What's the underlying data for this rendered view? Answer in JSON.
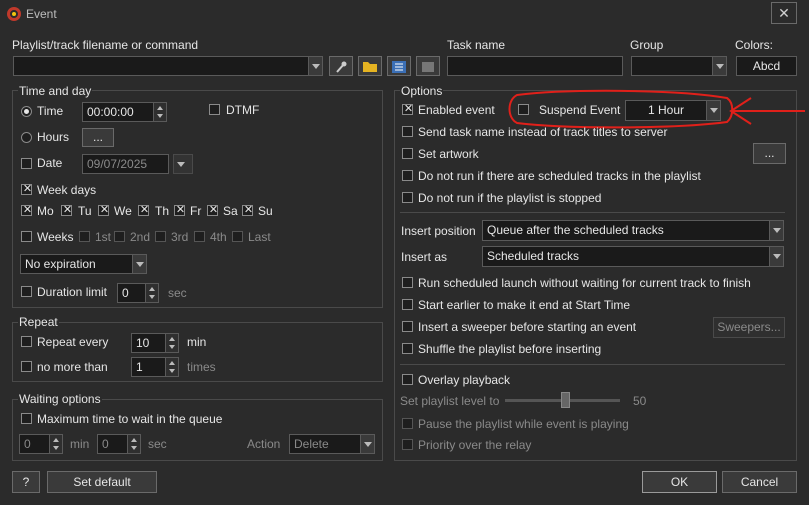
{
  "window": {
    "title": "Event",
    "close": "✕"
  },
  "top": {
    "playlist_label": "Playlist/track filename or command",
    "playlist_value": "",
    "task_label": "Task name",
    "task_value": "",
    "group_label": "Group",
    "group_value": "",
    "colors_label": "Colors:",
    "colors_value": "Abcd"
  },
  "time_and_day": {
    "legend": "Time and day",
    "time_label": "Time",
    "time_value": "00:00:00",
    "dtmf_label": "DTMF",
    "hours_label": "Hours",
    "hours_btn": "...",
    "date_label": "Date",
    "date_value": "09/07/2025",
    "weekdays_label": "Week days",
    "days": [
      "Mo",
      "Tu",
      "We",
      "Th",
      "Fr",
      "Sa",
      "Su"
    ],
    "weeks_label": "Weeks",
    "weeks": [
      "1st",
      "2nd",
      "3rd",
      "4th",
      "Last"
    ],
    "expiration_value": "No expiration",
    "duration_label": "Duration limit",
    "duration_value": "0",
    "duration_unit": "sec"
  },
  "repeat": {
    "legend": "Repeat",
    "repeat_every_label": "Repeat every",
    "repeat_every_value": "10",
    "repeat_every_unit": "min",
    "no_more_label": "no more than",
    "no_more_value": "1",
    "no_more_unit": "times"
  },
  "waiting": {
    "legend": "Waiting options",
    "max_label": "Maximum time to wait in the queue",
    "min_value": "0",
    "min_unit": "min",
    "sec_value": "0",
    "sec_unit": "sec",
    "action_label": "Action",
    "action_value": "Delete"
  },
  "options": {
    "legend": "Options",
    "enabled_label": "Enabled event",
    "suspend_label": "Suspend Event",
    "suspend_value": "1 Hour",
    "send_task_label": "Send task name instead of track titles to server",
    "set_artwork_label": "Set artwork",
    "artwork_btn": "...",
    "no_run_sched_label": "Do not run if there are scheduled tracks in the playlist",
    "no_run_stopped_label": "Do not run if the playlist is stopped",
    "insert_position_label": "Insert position",
    "insert_position_value": "Queue after the scheduled tracks",
    "insert_as_label": "Insert as",
    "insert_as_value": "Scheduled tracks",
    "run_sched_label": "Run scheduled launch without waiting for current track to finish",
    "start_earlier_label": "Start earlier to make it end at Start Time",
    "sweeper_label": "Insert a sweeper before starting an event",
    "sweepers_btn": "Sweepers...",
    "shuffle_label": "Shuffle the playlist before inserting",
    "overlay_label": "Overlay playback",
    "level_label": "Set playlist level to",
    "level_value": "50",
    "pause_label": "Pause the playlist while event is playing",
    "priority_label": "Priority over the relay"
  },
  "bottom": {
    "help": "?",
    "set_default": "Set default",
    "ok": "OK",
    "cancel": "Cancel"
  },
  "colors": {
    "annotation": "#e0201a",
    "bg": "#2b2b2b"
  }
}
